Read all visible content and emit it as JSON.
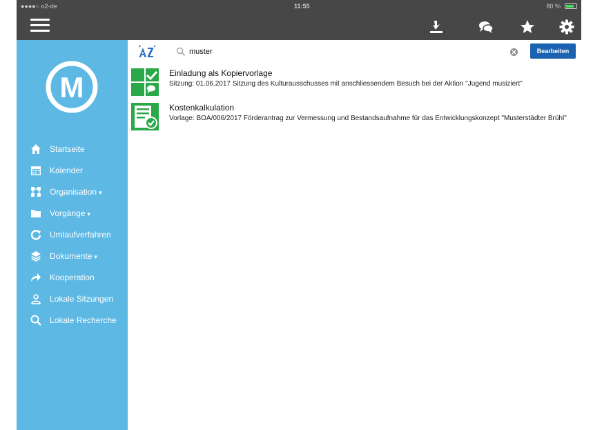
{
  "status_bar": {
    "carrier": "●●●●○ o2-de",
    "time": "11:55",
    "battery": "80 %",
    "battery_level": 0.8
  },
  "topbar": {
    "icons": [
      "menu-icon",
      "download-icon",
      "chat-icon",
      "star-icon",
      "gear-icon"
    ]
  },
  "sidebar": {
    "logo": "M",
    "items": [
      {
        "label": "Startseite",
        "icon": "home-icon",
        "dropdown": false
      },
      {
        "label": "Kalender",
        "icon": "calendar-icon",
        "dropdown": false
      },
      {
        "label": "Organisation",
        "icon": "organisation-icon",
        "dropdown": true
      },
      {
        "label": "Vorgänge",
        "icon": "folder-icon",
        "dropdown": true
      },
      {
        "label": "Umlaufverfahren",
        "icon": "refresh-icon",
        "dropdown": false
      },
      {
        "label": "Dokumente",
        "icon": "layers-icon",
        "dropdown": true
      },
      {
        "label": "Kooperation",
        "icon": "share-arrow-icon",
        "dropdown": false
      },
      {
        "label": "Lokale Sitzungen",
        "icon": "people-icon",
        "dropdown": false
      },
      {
        "label": "Lokale Recherche",
        "icon": "search-icon",
        "dropdown": false
      }
    ]
  },
  "search": {
    "value": "muster",
    "edit_label": "Bearbeiten"
  },
  "results": [
    {
      "title": "Einladung als Kopiervorlage",
      "description": "Sitzung:  01.06.2017  Sitzung des Kulturausschusses mit anschliessendem Besuch bei der Aktion \"Jugend musiziert\"",
      "icon": "meeting-check-icon"
    },
    {
      "title": "Kostenkalkulation",
      "description": "Vorlage: BOA/006/2017  Förderantrag zur Vermessung und Bestandsaufnahme für das Entwicklungskonzept \"Musterstädter Brühl\"",
      "icon": "document-check-icon"
    }
  ],
  "colors": {
    "topbar": "#474747",
    "sidebar": "#5db8e4",
    "button": "#1b62b0",
    "result_icon": "#2aa84a"
  }
}
